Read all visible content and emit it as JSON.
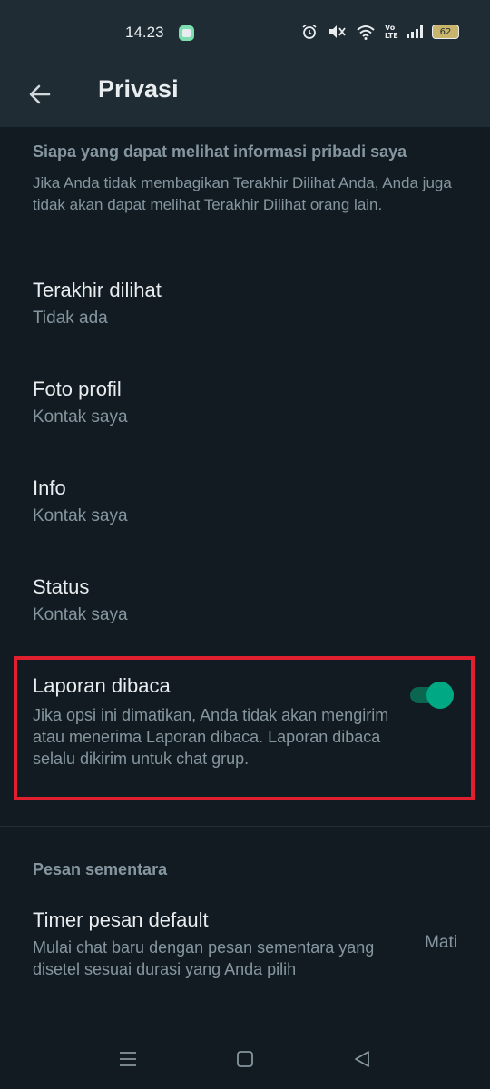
{
  "status_bar": {
    "time": "14.23",
    "battery": "62",
    "network_label": "Vo LTE"
  },
  "app_bar": {
    "title": "Privasi",
    "back_icon": "arrow-left-icon"
  },
  "section_personal": {
    "heading": "Siapa yang dapat melihat informasi pribadi saya",
    "description": "Jika Anda tidak membagikan Terakhir Dilihat Anda, Anda juga tidak akan dapat melihat Terakhir Dilihat orang lain."
  },
  "items": [
    {
      "label": "Terakhir dilihat",
      "value": "Tidak ada"
    },
    {
      "label": "Foto profil",
      "value": "Kontak saya"
    },
    {
      "label": "Info",
      "value": "Kontak saya"
    },
    {
      "label": "Status",
      "value": "Kontak saya"
    }
  ],
  "read_receipts": {
    "label": "Laporan dibaca",
    "description": "Jika opsi ini dimatikan, Anda tidak akan mengirim atau menerima Laporan dibaca. Laporan dibaca selalu dikirim untuk chat grup.",
    "enabled": true
  },
  "section_disappearing": {
    "heading": "Pesan sementara"
  },
  "default_timer": {
    "label": "Timer pesan default",
    "description": "Mulai chat baru dengan pesan sementara yang disetel sesuai durasi yang Anda pilih",
    "value": "Mati"
  },
  "colors": {
    "background": "#111b21",
    "bar": "#1f2c34",
    "accent": "#00a884",
    "highlight": "#e0202e"
  }
}
